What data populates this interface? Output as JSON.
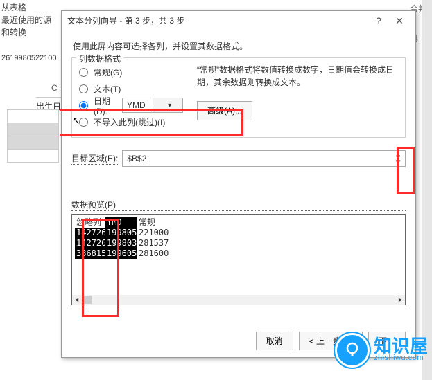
{
  "ribbon": {
    "items": [
      "从表格",
      "最近使用的源",
      "和转换"
    ],
    "right": "合并",
    "right2": "具"
  },
  "formula_bar": "2619980522100",
  "sheet": {
    "col": "C",
    "label": "出生日"
  },
  "dialog": {
    "title": "文本分列向导 - 第 3 步，共 3 步",
    "help": "?",
    "close": "✕",
    "desc": "使用此屏内容可选择各列，并设置其数据格式。",
    "fieldset_legend": "列数据格式",
    "radios": {
      "general": "常规(G)",
      "text": "文本(T)",
      "date": "日期(D):",
      "skip": "不导入此列(跳过)(I)"
    },
    "date_fmt": "YMD",
    "right_desc1": "“常规”数据格式将数值转换成数字，日期值会转换成日",
    "right_desc2": "期，其余数据则转换成文本。",
    "advanced": "高级(A)...",
    "target_label": "目标区域(E):",
    "target_value": "$B$2",
    "preview_label": "数据预览(P)",
    "preview": {
      "headers": [
        "忽略列",
        "YMD",
        "常规"
      ],
      "rows": [
        [
          "142726",
          "199805",
          "221000"
        ],
        [
          "142726",
          "199803",
          "281537"
        ],
        [
          "336815",
          "199605",
          "281600"
        ]
      ]
    },
    "buttons": {
      "cancel": "取消",
      "back": "< 上一步(B)",
      "next": "下一"
    }
  },
  "watermark": {
    "name": "知识屋",
    "url": "zhishiwu.com"
  }
}
